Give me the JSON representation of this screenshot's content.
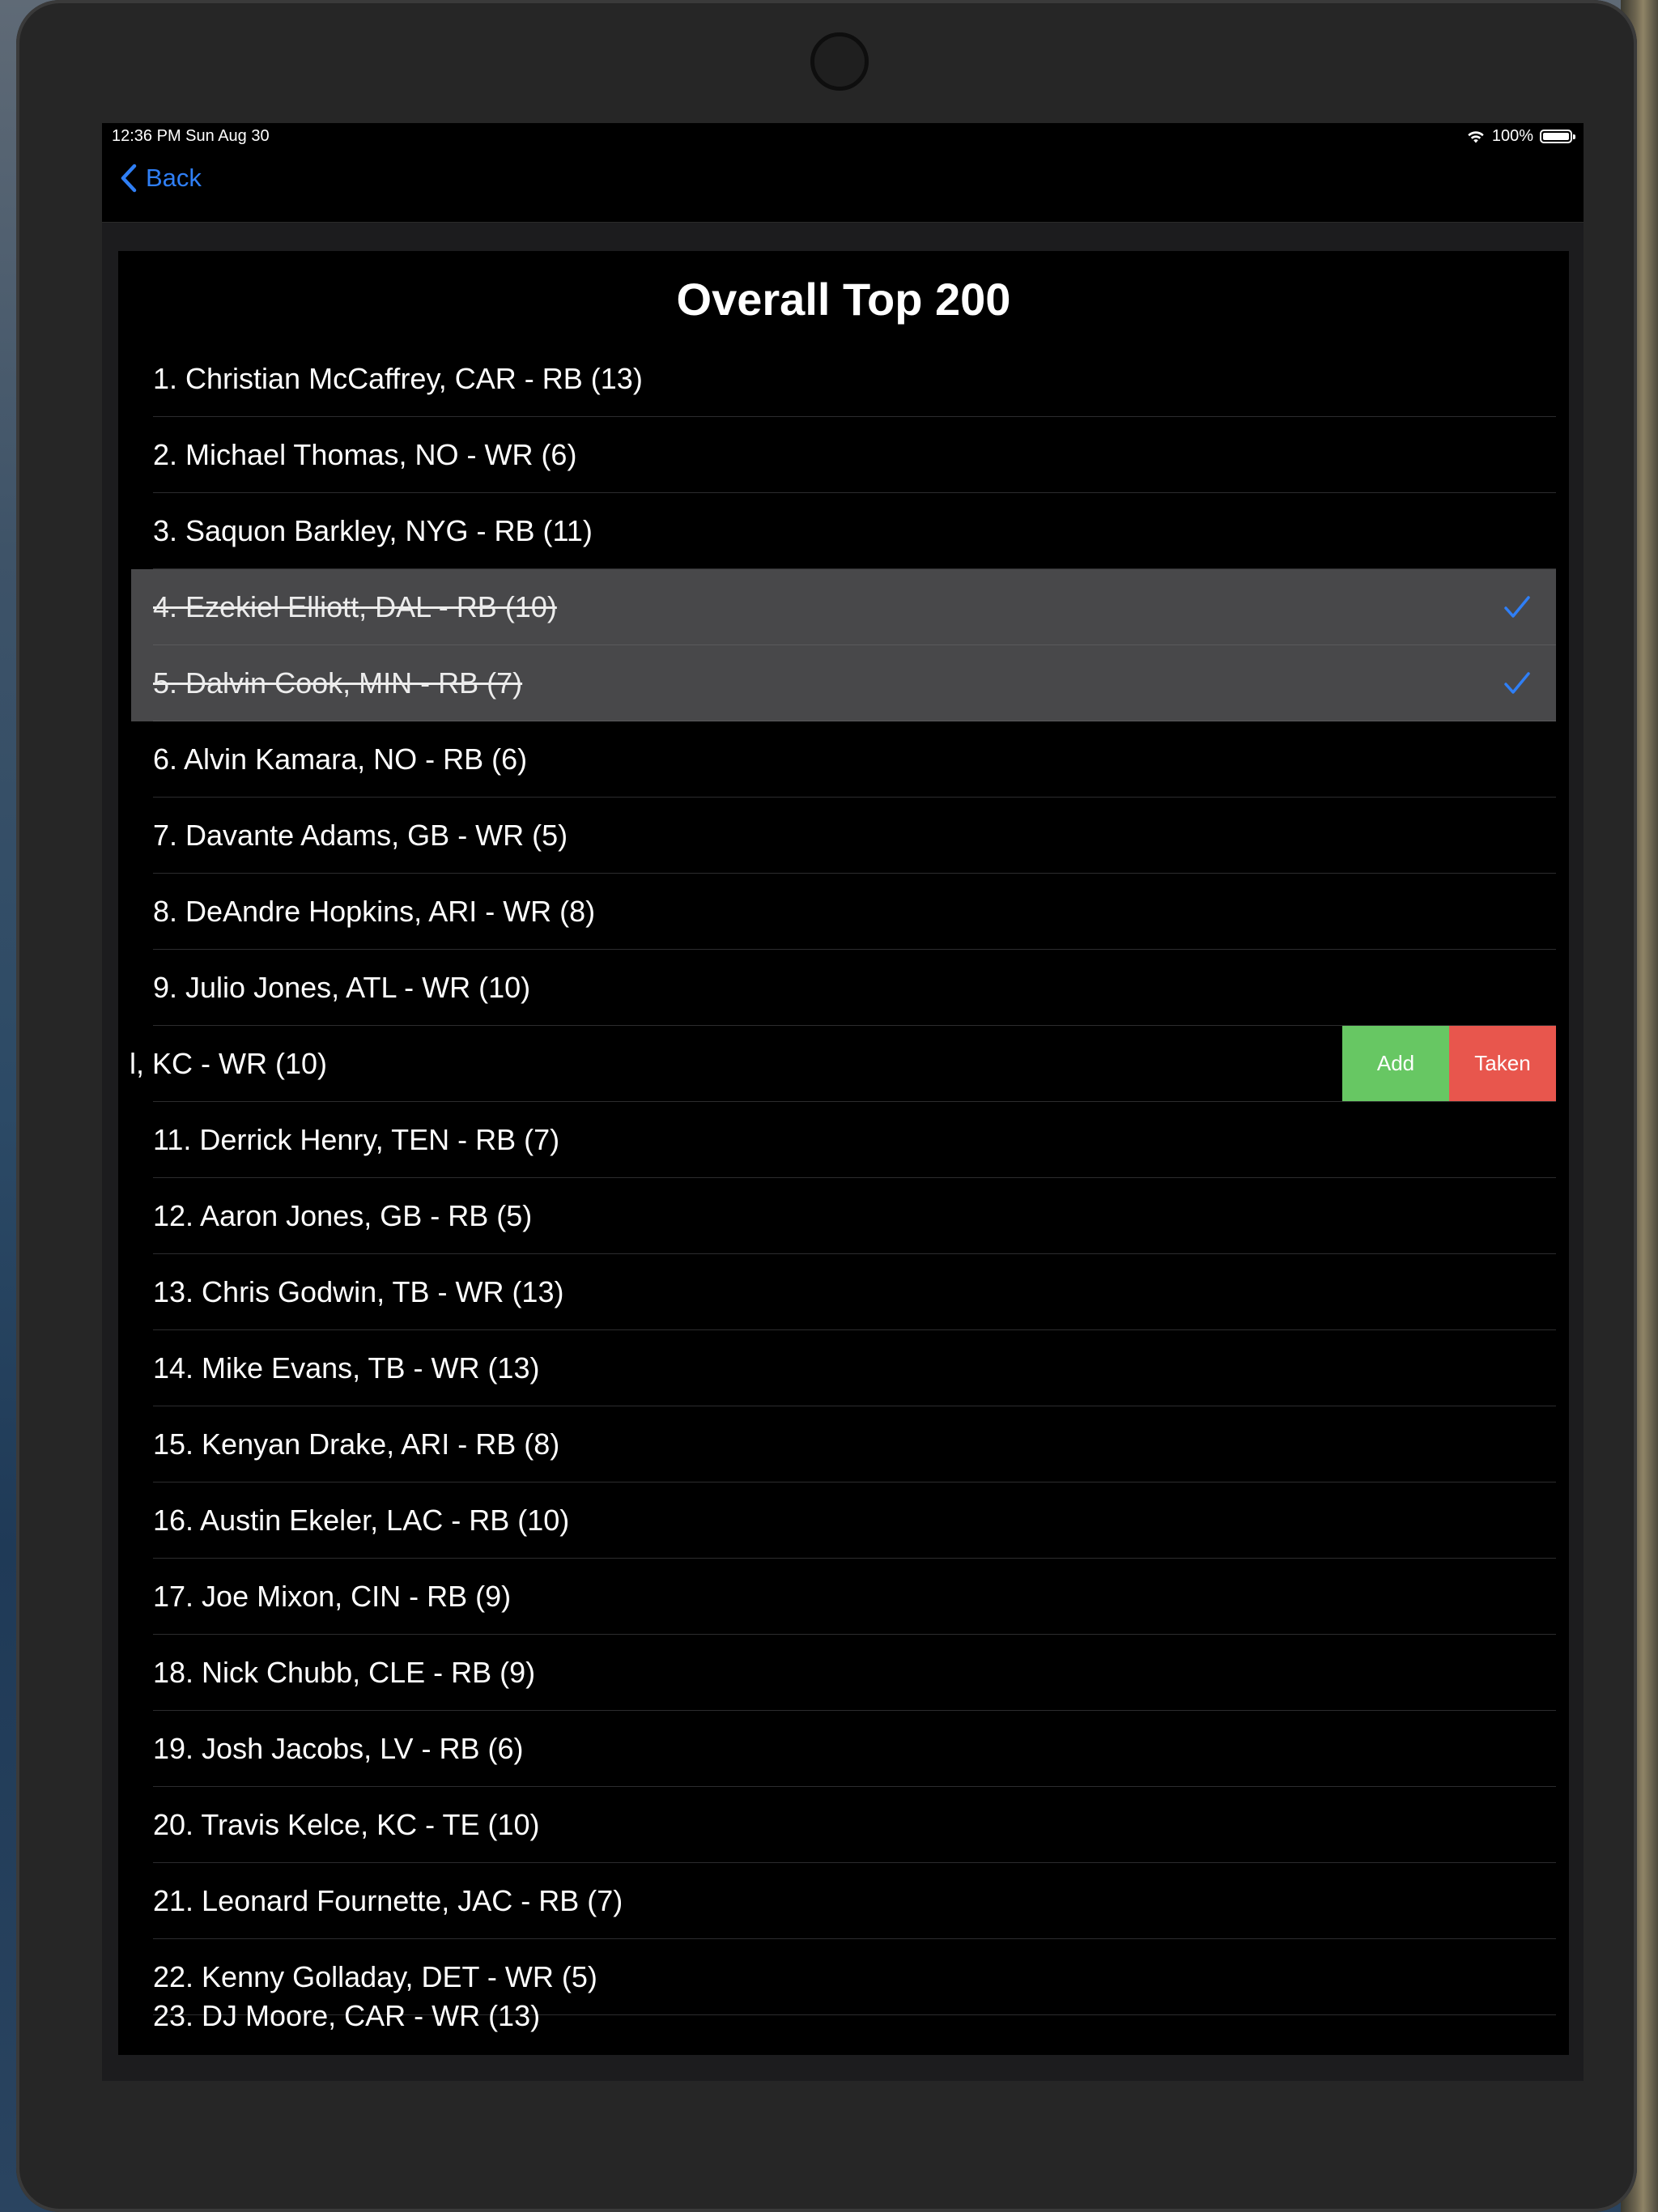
{
  "status_bar": {
    "time": "12:36 PM   Sun Aug 30",
    "battery": "100%"
  },
  "nav": {
    "back_label": "Back"
  },
  "list": {
    "title": "Overall Top 200",
    "rows": [
      {
        "text": "1.  Christian McCaffrey,  CAR - RB (13)",
        "taken": false
      },
      {
        "text": "2.  Michael Thomas,  NO - WR (6)",
        "taken": false
      },
      {
        "text": "3.  Saquon Barkley,  NYG - RB (11)",
        "taken": false
      },
      {
        "text": "4.  Ezekiel Elliott,  DAL - RB (10)",
        "taken": true
      },
      {
        "text": "5.  Dalvin Cook,  MIN - RB (7)",
        "taken": true
      },
      {
        "text": "6.  Alvin Kamara,  NO - RB (6)",
        "taken": false
      },
      {
        "text": "7.  Davante Adams,  GB - WR (5)",
        "taken": false
      },
      {
        "text": "8.  DeAndre Hopkins,  ARI - WR (8)",
        "taken": false
      },
      {
        "text": "9.  Julio Jones,  ATL - WR (10)",
        "taken": false
      },
      {
        "text": "l,  KC - WR (10)",
        "taken": false,
        "swiped": true
      },
      {
        "text": "11.  Derrick Henry,  TEN - RB (7)",
        "taken": false
      },
      {
        "text": "12.  Aaron Jones,  GB - RB (5)",
        "taken": false
      },
      {
        "text": "13.  Chris Godwin,  TB - WR (13)",
        "taken": false
      },
      {
        "text": "14.  Mike Evans,  TB - WR (13)",
        "taken": false
      },
      {
        "text": "15.  Kenyan Drake,  ARI - RB (8)",
        "taken": false
      },
      {
        "text": "16.  Austin Ekeler,  LAC - RB (10)",
        "taken": false
      },
      {
        "text": "17.  Joe Mixon,  CIN - RB (9)",
        "taken": false
      },
      {
        "text": "18.  Nick Chubb,  CLE - RB (9)",
        "taken": false
      },
      {
        "text": "19.  Josh Jacobs,  LV - RB (6)",
        "taken": false
      },
      {
        "text": "20.  Travis Kelce,  KC - TE (10)",
        "taken": false
      },
      {
        "text": "21.  Leonard Fournette,  JAC - RB (7)",
        "taken": false
      },
      {
        "text": "22.  Kenny Golladay,  DET - WR (5)",
        "taken": false
      },
      {
        "text": "23.  DJ Moore,  CAR - WR (13)",
        "taken": false
      }
    ],
    "swipe_actions": {
      "add_label": "Add",
      "taken_label": "Taken"
    }
  },
  "colors": {
    "accent_blue": "#2f7ff6",
    "add_green": "#67c763",
    "taken_red": "#e8564d",
    "taken_row_bg": "#48484a"
  }
}
